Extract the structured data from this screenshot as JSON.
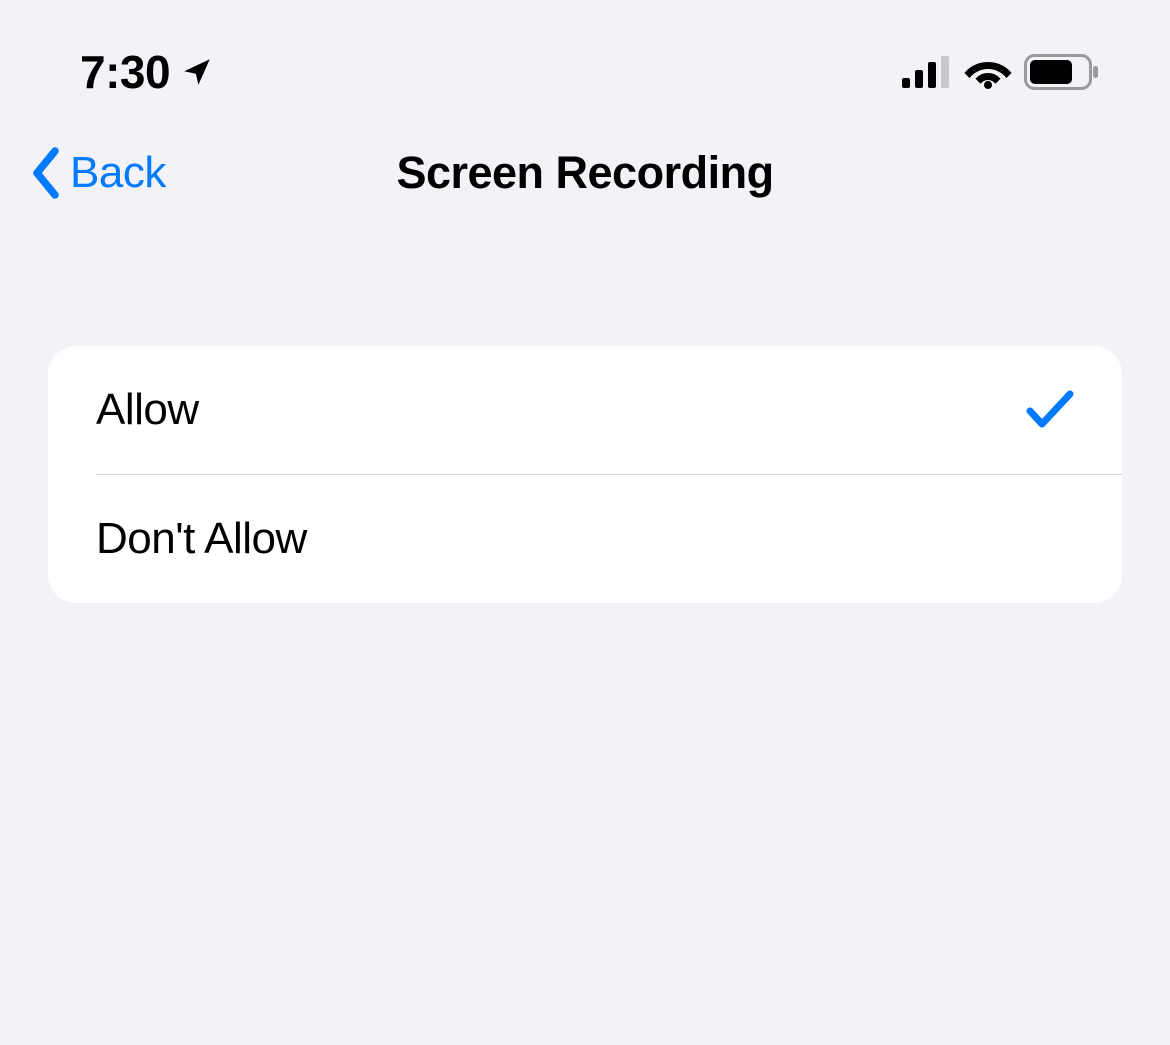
{
  "statusBar": {
    "time": "7:30"
  },
  "nav": {
    "backLabel": "Back",
    "title": "Screen Recording"
  },
  "options": [
    {
      "label": "Allow",
      "selected": true
    },
    {
      "label": "Don't Allow",
      "selected": false
    }
  ],
  "colors": {
    "accent": "#007aff",
    "background": "#f2f2f7",
    "cardBackground": "#ffffff"
  }
}
